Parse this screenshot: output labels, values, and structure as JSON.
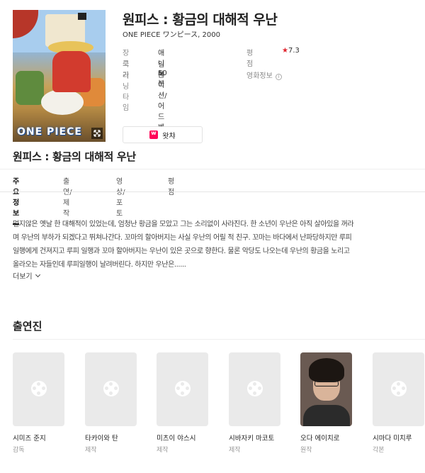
{
  "movie": {
    "title": "원피스 : 황금의 대해적 우난",
    "subtitle": "ONE PIECE ワンピース, 2000",
    "poster_logo": "ONE PIECE"
  },
  "info": {
    "genre_label": "장르",
    "genre_value": "애니메이션/어드벤처",
    "rating_label": "평점",
    "rating_star": "★",
    "rating_value": "7.3",
    "country_label": "국가",
    "country_value": "일본",
    "movieinfo_label": "영화정보",
    "movieinfo_icon": "i",
    "runtime_label": "러닝타임",
    "runtime_value": "50분"
  },
  "watcha_button": {
    "label": "왓챠"
  },
  "tabs": [
    {
      "label": "주요정보",
      "active": true
    },
    {
      "label": "출연/제작",
      "active": false
    },
    {
      "label": "영상/포토",
      "active": false
    },
    {
      "label": "평점",
      "active": false
    }
  ],
  "synopsis": {
    "lines": [
      "멀지않은 옛날 한 대해적이 있었는데, 엄청난 황금을 모았고 그는 소리없이 사라진다. 한 소년이 우난은 아직 살아있을 꺼라",
      "며 우난의 부하가 되겠다고 뛰쳐나간다. 꼬마의 할아버지는 사실 우난의 어릴 적 친구. 꼬마는 바다에서 난파당하지만 루피",
      "일행에게 건져지고 루피 일행과 꼬마 할아버지는 우난이 있은 곳으로 향한다. 물론 악당도 나오는데 우난의 황금을 노리고",
      "올라오는 자들인데 루피일행이 날려버린다. 하지만 우난은......"
    ],
    "more_label": "더보기"
  },
  "cast": {
    "title": "출연진",
    "members": [
      {
        "name": "시미즈 준지",
        "role": "감독",
        "photo": "placeholder"
      },
      {
        "name": "타카이와 탄",
        "role": "제작",
        "photo": "placeholder"
      },
      {
        "name": "미츠이 야스시",
        "role": "제작",
        "photo": "placeholder"
      },
      {
        "name": "시바자키 마코토",
        "role": "제작",
        "photo": "placeholder"
      },
      {
        "name": "오다 에이치로",
        "role": "원작",
        "photo": "portrait"
      },
      {
        "name": "시마다 미치루",
        "role": "각본",
        "photo": "placeholder"
      }
    ]
  },
  "colors": {
    "accent_red": "#e0252f",
    "watcha_pink": "#ff0558"
  }
}
